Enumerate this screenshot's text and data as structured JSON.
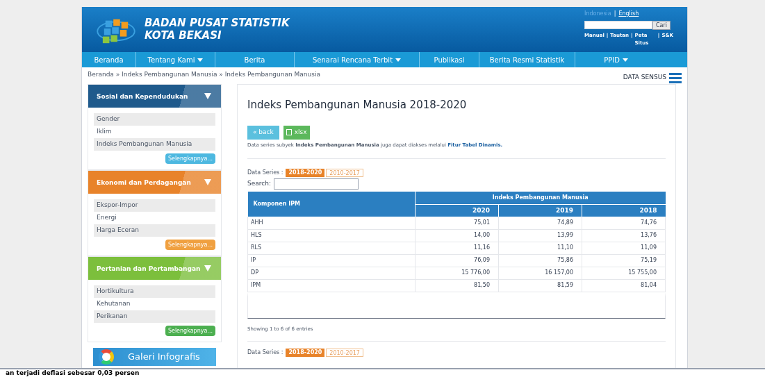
{
  "header": {
    "title_line_1": "BADAN PUSAT STATISTIK",
    "title_line_2": "KOTA BEKASI",
    "languages": [
      {
        "label": "Indonesia",
        "selected": true
      },
      {
        "label": "English",
        "selected": false
      }
    ],
    "language_separator": "|",
    "search_button": "Cari",
    "links": [
      "Manual",
      "Tautan",
      "Peta Situs",
      "S&K"
    ],
    "link_separator": "|"
  },
  "nav": [
    {
      "label": "Beranda",
      "dropdown": false
    },
    {
      "label": "Tentang Kami",
      "dropdown": true
    },
    {
      "label": "Berita",
      "dropdown": false
    },
    {
      "label": "Senarai Rencana Terbit",
      "dropdown": true
    },
    {
      "label": "Publikasi",
      "dropdown": false
    },
    {
      "label": "Berita Resmi Statistik",
      "dropdown": false
    },
    {
      "label": "PPID",
      "dropdown": true
    }
  ],
  "breadcrumb": [
    "Beranda",
    "Indeks Pembangunan Manusia",
    "Indeks Pembangunan Manusia"
  ],
  "breadcrumb_separator": "»",
  "data_sensus": "DATA SENSUS",
  "sidebar": [
    {
      "title": "Sosial dan Kependudukan",
      "kind": "social",
      "items": [
        "Gender",
        "Iklim",
        "Indeks Pembangunan Manusia"
      ],
      "more": "Selengkapnya..."
    },
    {
      "title": "Ekonomi dan Perdagangan",
      "kind": "economy",
      "items": [
        "Ekspor-Impor",
        "Energi",
        "Harga Eceran"
      ],
      "more": "Selengkapnya..."
    },
    {
      "title": "Pertanian dan Pertambangan",
      "kind": "agriculture",
      "items": [
        "Hortikultura",
        "Kehutanan",
        "Perikanan"
      ],
      "more": "Selengkapnya..."
    }
  ],
  "infographic_banner": "Galeri Infografis",
  "main": {
    "title": "Indeks Pembangunan Manusia 2018-2020",
    "back_button": "« back",
    "xlsx_button": "xlsx",
    "note": "Data series subyek **Indeks Pembangunan Manusia** juga dapat diakses melalui",
    "note_link": "Fitur Tabel Dinamis.",
    "series_label": "Data Series :",
    "series": [
      {
        "label": "2018-2020",
        "selected": true
      },
      {
        "label": "2010-2017",
        "selected": false
      }
    ],
    "search_label": "Search:",
    "table": {
      "row_header": "Komponen IPM",
      "group_header": "Indeks Pembangunan Manusia",
      "years": [
        "2020",
        "2019",
        "2018"
      ],
      "rows": [
        [
          "AHH",
          "75,01",
          "74,89",
          "74,76"
        ],
        [
          "HLS",
          "14,00",
          "13,99",
          "13,76"
        ],
        [
          "RLS",
          "11,16",
          "11,10",
          "11,09"
        ],
        [
          "IP",
          "76,09",
          "75,86",
          "75,19"
        ],
        [
          "DP",
          "15 776,00",
          "16 157,00",
          "15 755,00"
        ],
        [
          "IPM",
          "81,50",
          "81,59",
          "81,04"
        ]
      ]
    },
    "info": "Showing 1 to 6 of 6 entries",
    "series_label_2": "Data Series :",
    "series_2": [
      {
        "label": "2018-2020",
        "selected": true
      },
      {
        "label": "2010-2017",
        "selected": false
      }
    ]
  },
  "ticker": "an terjadi deflasi sebesar 0,03 persen"
}
